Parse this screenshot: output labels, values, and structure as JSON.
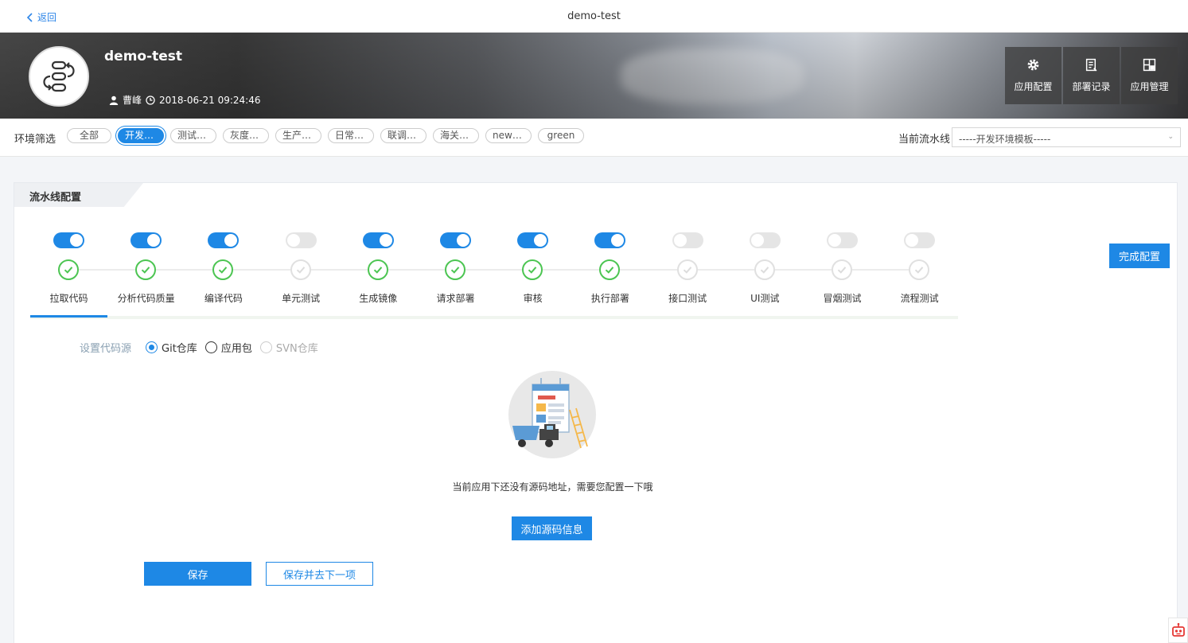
{
  "topbar": {
    "back_label": "返回",
    "title": "demo-test"
  },
  "app": {
    "name": "demo-test",
    "owner": "曹峰",
    "created": "2018-06-21 09:24:46"
  },
  "header_actions": [
    {
      "label": "应用配置",
      "icon": "gear-icon"
    },
    {
      "label": "部署记录",
      "icon": "record-icon"
    },
    {
      "label": "应用管理",
      "icon": "grid-icon"
    }
  ],
  "env_filter": {
    "label": "环境筛选",
    "chips": [
      "全部",
      "开发环境",
      "测试环境",
      "灰度环境",
      "生产环境",
      "日常环境",
      "联调环境",
      "海关poc",
      "new+{{r...",
      "green"
    ],
    "selected_index": 1
  },
  "pipeline": {
    "label": "当前流水线",
    "selected": "-----开发环境模板-----"
  },
  "panel": {
    "title": "流水线配置",
    "done_button": "完成配置",
    "steps": [
      {
        "label": "拉取代码",
        "enabled": true
      },
      {
        "label": "分析代码质量",
        "enabled": true
      },
      {
        "label": "编译代码",
        "enabled": true
      },
      {
        "label": "单元测试",
        "enabled": false
      },
      {
        "label": "生成镜像",
        "enabled": true
      },
      {
        "label": "请求部署",
        "enabled": true
      },
      {
        "label": "审核",
        "enabled": true
      },
      {
        "label": "执行部署",
        "enabled": true
      },
      {
        "label": "接口测试",
        "enabled": false
      },
      {
        "label": "UI测试",
        "enabled": false
      },
      {
        "label": "冒烟测试",
        "enabled": false
      },
      {
        "label": "流程测试",
        "enabled": false
      }
    ],
    "active_step": 0,
    "source": {
      "label": "设置代码源",
      "options": [
        {
          "label": "Git仓库",
          "checked": true,
          "disabled": false
        },
        {
          "label": "应用包",
          "checked": false,
          "disabled": false
        },
        {
          "label": "SVN仓库",
          "checked": false,
          "disabled": true
        }
      ]
    },
    "empty_message": "当前应用下还没有源码地址，需要您配置一下哦",
    "add_source_button": "添加源码信息",
    "save_button": "保存",
    "save_next_button": "保存并去下一项"
  },
  "colors": {
    "primary": "#1e88e5",
    "success": "#4cc552"
  }
}
